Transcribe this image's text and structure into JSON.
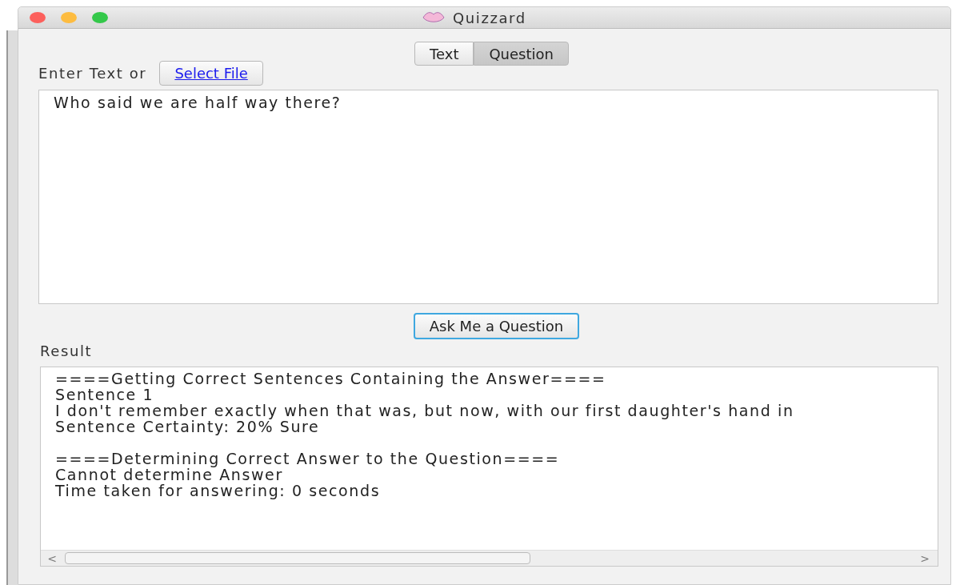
{
  "window": {
    "title": "Quizzard"
  },
  "tabs": [
    {
      "label": "Text",
      "selected": false
    },
    {
      "label": "Question",
      "selected": true
    }
  ],
  "input_label": "Enter Text or",
  "select_file_button": "Select File",
  "text_input": {
    "value": "Who said we are half way there?"
  },
  "ask_button": {
    "label": "Ask Me a Question",
    "focused": true
  },
  "result_label": "Result",
  "result_blocks": [
    [
      "====Getting Correct Sentences Containing the Answer====",
      "Sentence 1",
      "I don't remember exactly when that was, but now, with our first daughter's hand in",
      "Sentence Certainty: 20% Sure"
    ],
    [
      "====Determining Correct Answer to the Question====",
      "Cannot determine Answer",
      "Time taken for answering: 0 seconds"
    ]
  ],
  "scrollbar": {
    "left_arrow": "<",
    "right_arrow": ">"
  }
}
